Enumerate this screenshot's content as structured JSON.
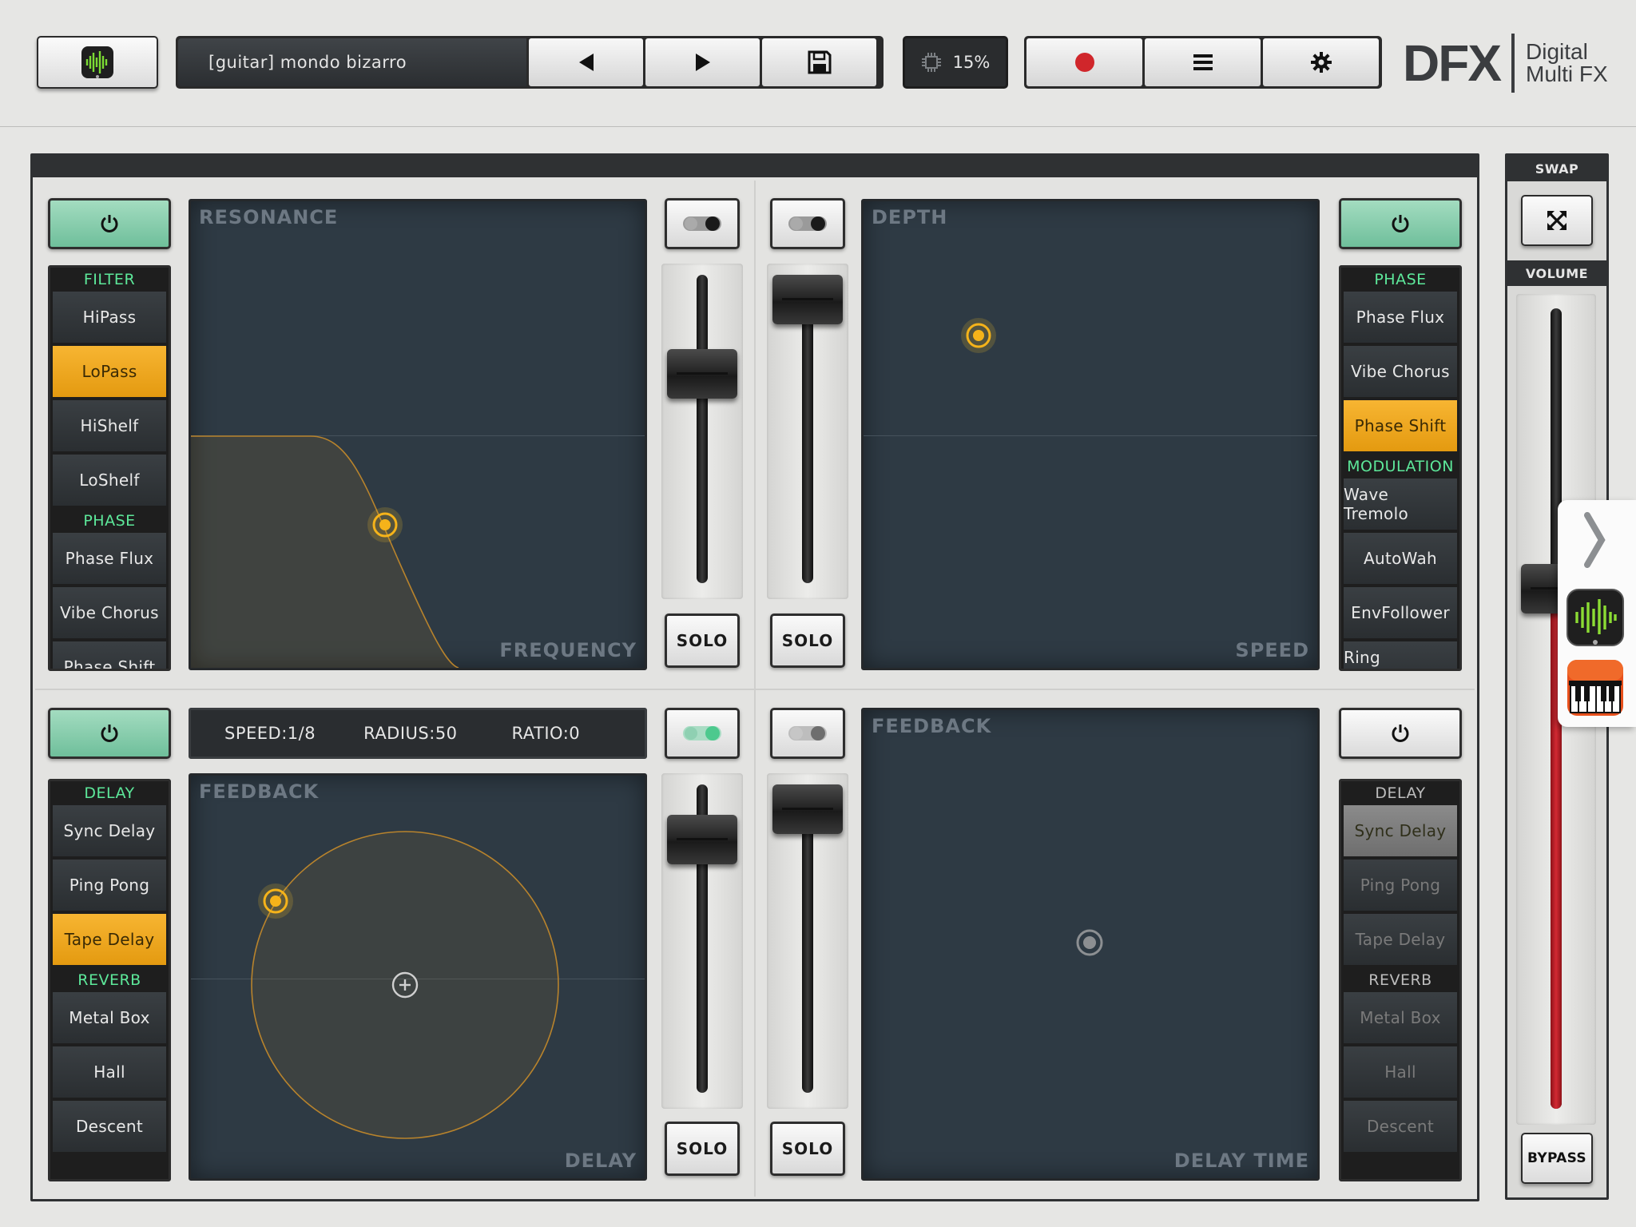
{
  "header": {
    "preset_name": "[guitar] mondo bizarro",
    "cpu": "15%",
    "logo": "DFX",
    "logo_sub1": "Digital",
    "logo_sub2": "Multi FX"
  },
  "top_left": {
    "filter": {
      "header": "FILTER",
      "items": [
        "HiPass",
        "LoPass",
        "HiShelf",
        "LoShelf"
      ],
      "phase_header": "PHASE",
      "phase_items": [
        "Phase Flux",
        "Vibe Chorus",
        "Phase Shift"
      ]
    },
    "pad_y": "RESONANCE",
    "pad_x": "FREQUENCY"
  },
  "top_right": {
    "phase_header": "PHASE",
    "phase_items": [
      "Phase Flux",
      "Vibe Chorus",
      "Phase Shift"
    ],
    "mod_header": "MODULATION",
    "mod_items": [
      "Wave Tremolo",
      "AutoWah",
      "EnvFollower",
      "Ring Modulator"
    ],
    "pad_y": "DEPTH",
    "pad_x": "SPEED"
  },
  "bottom_left": {
    "delay_header": "DELAY",
    "delay_items": [
      "Sync Delay",
      "Ping Pong",
      "Tape Delay"
    ],
    "reverb_header": "REVERB",
    "reverb_items": [
      "Metal Box",
      "Hall",
      "Descent"
    ],
    "params": {
      "speed": "SPEED:1/8",
      "radius": "RADIUS:50",
      "ratio": "RATIO:0"
    },
    "pad_y": "FEEDBACK",
    "pad_x": "DELAY"
  },
  "bottom_right": {
    "delay_header": "DELAY",
    "delay_items": [
      "Sync Delay",
      "Ping Pong",
      "Tape Delay"
    ],
    "reverb_header": "REVERB",
    "reverb_items": [
      "Metal Box",
      "Hall",
      "Descent"
    ],
    "pad_y": "FEEDBACK",
    "pad_x": "DELAY TIME"
  },
  "solo_label": "SOLO",
  "side": {
    "swap": "SWAP",
    "volume": "VOLUME",
    "bypass": "BYPASS",
    "volume_level": 0.65
  },
  "colors": {
    "accent_orange": "#f3a81c",
    "power_on": "#7fcaa8",
    "green_header": "#5de89a",
    "record_red": "#d0262b",
    "volume_red": "#c8202a"
  }
}
